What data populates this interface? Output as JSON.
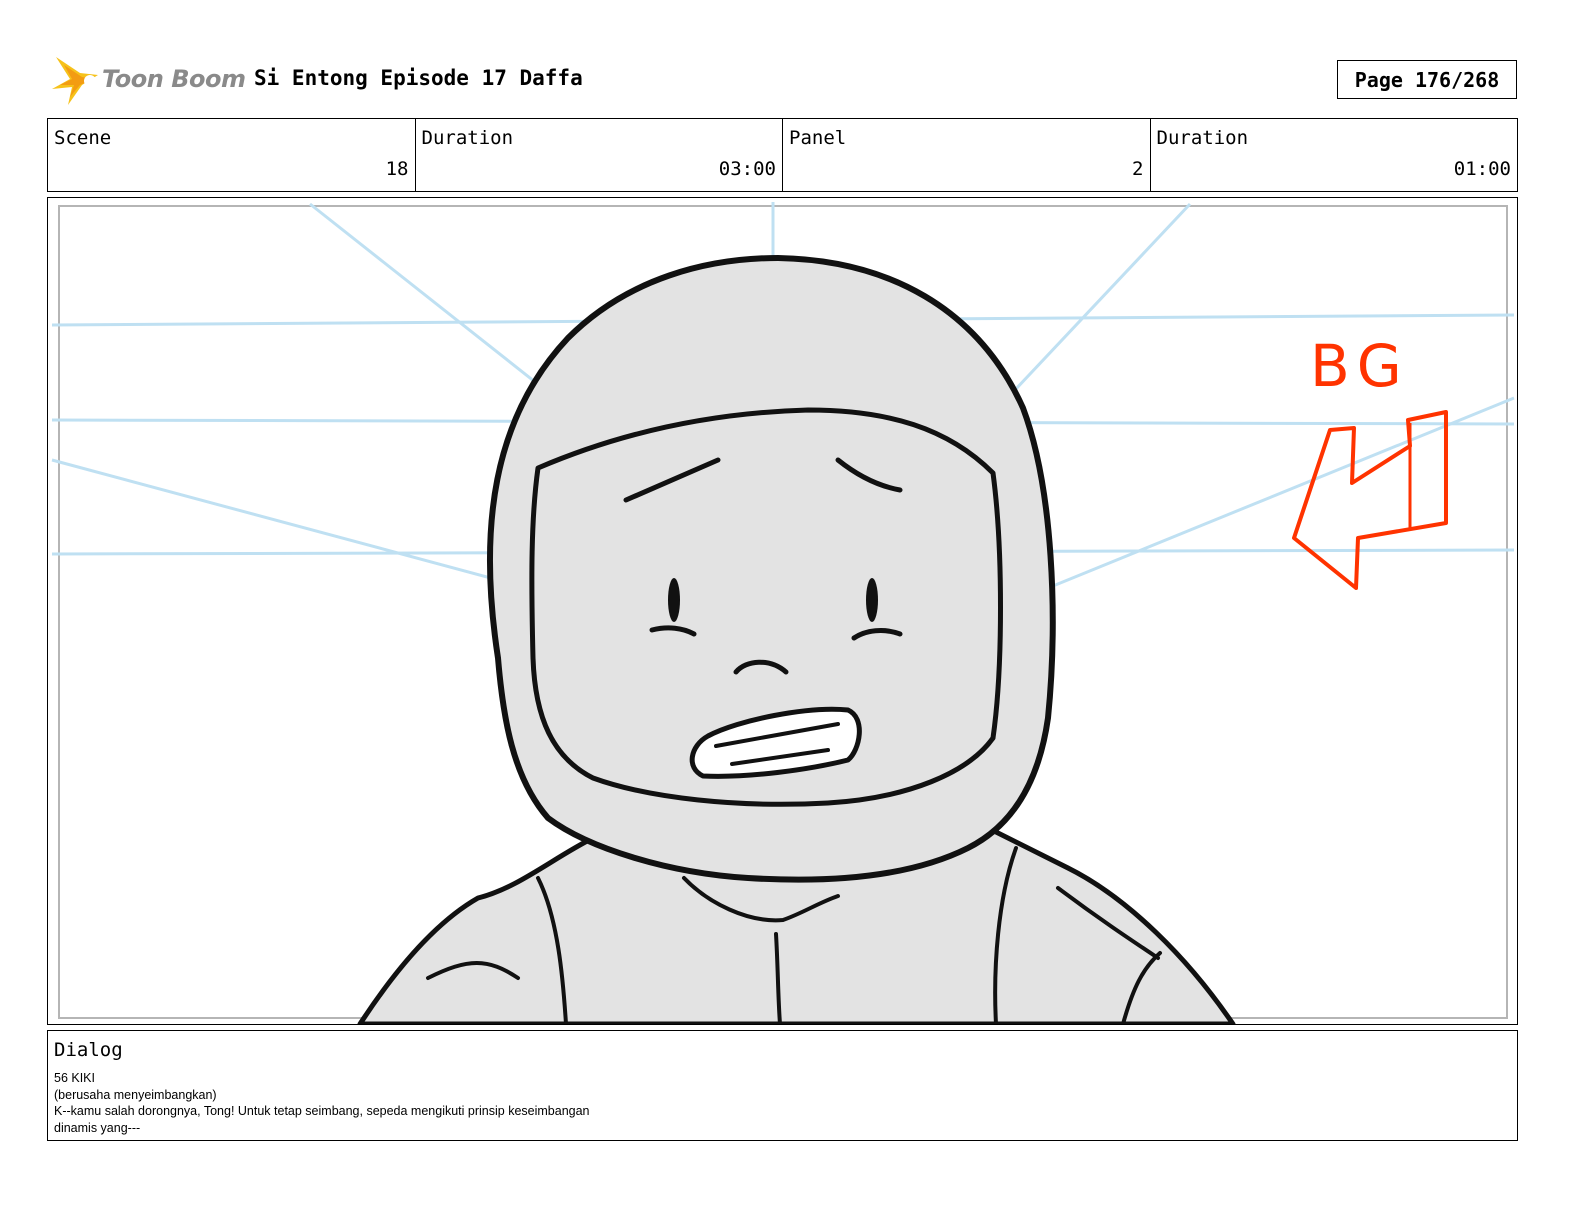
{
  "header": {
    "logo_text": "Toon Boom",
    "title": "Si Entong Episode 17 Daffa",
    "page": "Page 176/268"
  },
  "info": {
    "scene_label": "Scene",
    "scene_value": "18",
    "scene_duration_label": "Duration",
    "scene_duration_value": "03:00",
    "panel_label": "Panel",
    "panel_value": "2",
    "panel_duration_label": "Duration",
    "panel_duration_value": "01:00"
  },
  "panel": {
    "annotation": "BG",
    "colors": {
      "guide": "#bfe0f2",
      "annotation": "#ff3300",
      "ink": "#111111",
      "fill": "#e3e3e3"
    }
  },
  "dialog": {
    "label": "Dialog",
    "lines": [
      "56 KIKI",
      "(berusaha menyeimbangkan)",
      "K--kamu salah dorongnya, Tong! Untuk tetap seimbang, sepeda mengikuti prinsip keseimbangan",
      "dinamis yang---"
    ]
  }
}
